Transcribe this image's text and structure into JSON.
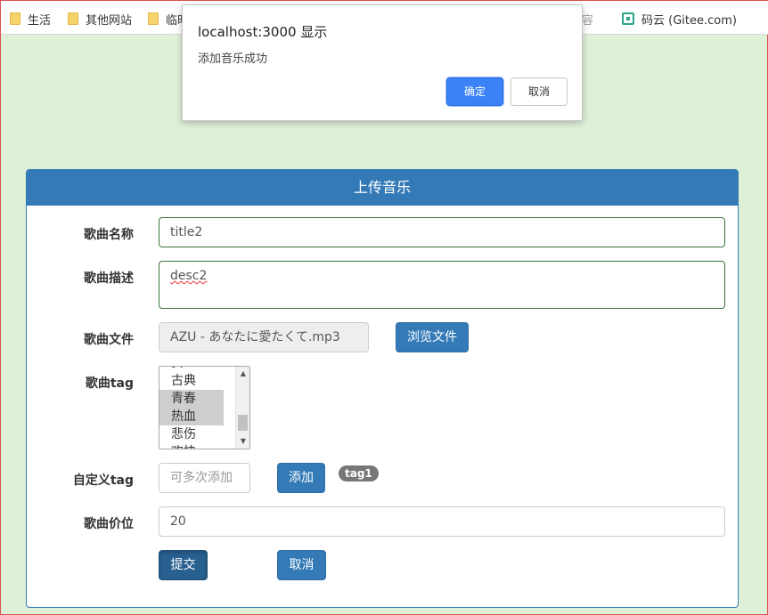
{
  "bookmarks": [
    {
      "label": "生活",
      "icon": "folder-icon"
    },
    {
      "label": "其他网站",
      "icon": "folder-icon"
    },
    {
      "label": "临时",
      "icon": "folder-icon"
    },
    {
      "label": "同内容",
      "icon": "folder-icon"
    },
    {
      "label": "码云 (Gitee.com)",
      "icon": "gitee-icon"
    }
  ],
  "dialog": {
    "title": "localhost:3000 显示",
    "message": "添加音乐成功",
    "ok_label": "确定",
    "cancel_label": "取消"
  },
  "panel": {
    "heading": "上传音乐"
  },
  "form": {
    "title": {
      "label": "歌曲名称",
      "value": "title2"
    },
    "description": {
      "label": "歌曲描述",
      "value": "desc2"
    },
    "file": {
      "label": "歌曲文件",
      "value": "AZU - あなたに愛たくて.mp3",
      "browse_label": "浏览文件"
    },
    "tag": {
      "label": "歌曲tag",
      "options": [
        {
          "label": "安",
          "selected": false
        },
        {
          "label": "古典",
          "selected": false
        },
        {
          "label": "青春",
          "selected": true
        },
        {
          "label": "热血",
          "selected": true
        },
        {
          "label": "悲伤",
          "selected": false
        },
        {
          "label": "欢快",
          "selected": false
        }
      ]
    },
    "custom_tag": {
      "label": "自定义tag",
      "placeholder": "可多次添加",
      "add_label": "添加",
      "tags": [
        "tag1"
      ]
    },
    "price": {
      "label": "歌曲价位",
      "value": "20"
    },
    "submit_label": "提交",
    "cancel_label": "取消"
  },
  "colors": {
    "primary": "#337ab7",
    "page_bg": "#dff0d8",
    "success_border": "#3c763d",
    "badge": "#777777",
    "dialog_ok": "#3b82f6"
  }
}
